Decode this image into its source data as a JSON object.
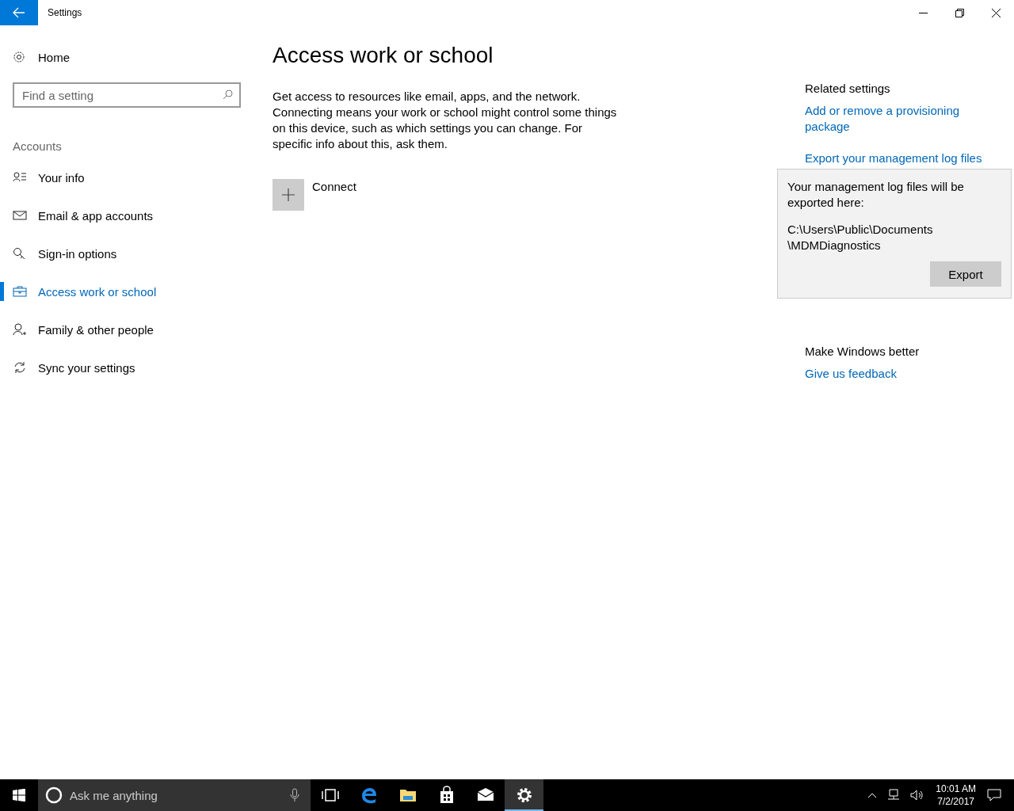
{
  "window": {
    "title": "Settings"
  },
  "sidebar": {
    "home": "Home",
    "search": {
      "placeholder": "Find a setting"
    },
    "section": "Accounts",
    "items": [
      {
        "label": "Your info",
        "selected": false
      },
      {
        "label": "Email & app accounts",
        "selected": false
      },
      {
        "label": "Sign-in options",
        "selected": false
      },
      {
        "label": "Access work or school",
        "selected": true
      },
      {
        "label": "Family & other people",
        "selected": false
      },
      {
        "label": "Sync your settings",
        "selected": false
      }
    ]
  },
  "main": {
    "heading": "Access work or school",
    "description": "Get access to resources like email, apps, and the network. Connecting means your work or school might control some things on this device, such as which settings you can change. For specific info about this, ask them.",
    "connect": "Connect"
  },
  "related": {
    "heading": "Related settings",
    "links": [
      "Add or remove a provisioning package",
      "Export your management log files"
    ],
    "better_heading": "Make Windows better",
    "feedback": "Give us feedback"
  },
  "popup": {
    "message": "Your management log files will be exported here:",
    "path": "C:\\Users\\Public\\Documents \\MDMDiagnostics",
    "button": "Export"
  },
  "taskbar": {
    "search_placeholder": "Ask me anything",
    "apps": [
      {
        "selected": false
      },
      {
        "selected": false
      },
      {
        "selected": false
      },
      {
        "selected": false
      },
      {
        "selected": false
      },
      {
        "selected": true
      }
    ],
    "time": "10:01 AM",
    "date": "7/2/2017"
  }
}
